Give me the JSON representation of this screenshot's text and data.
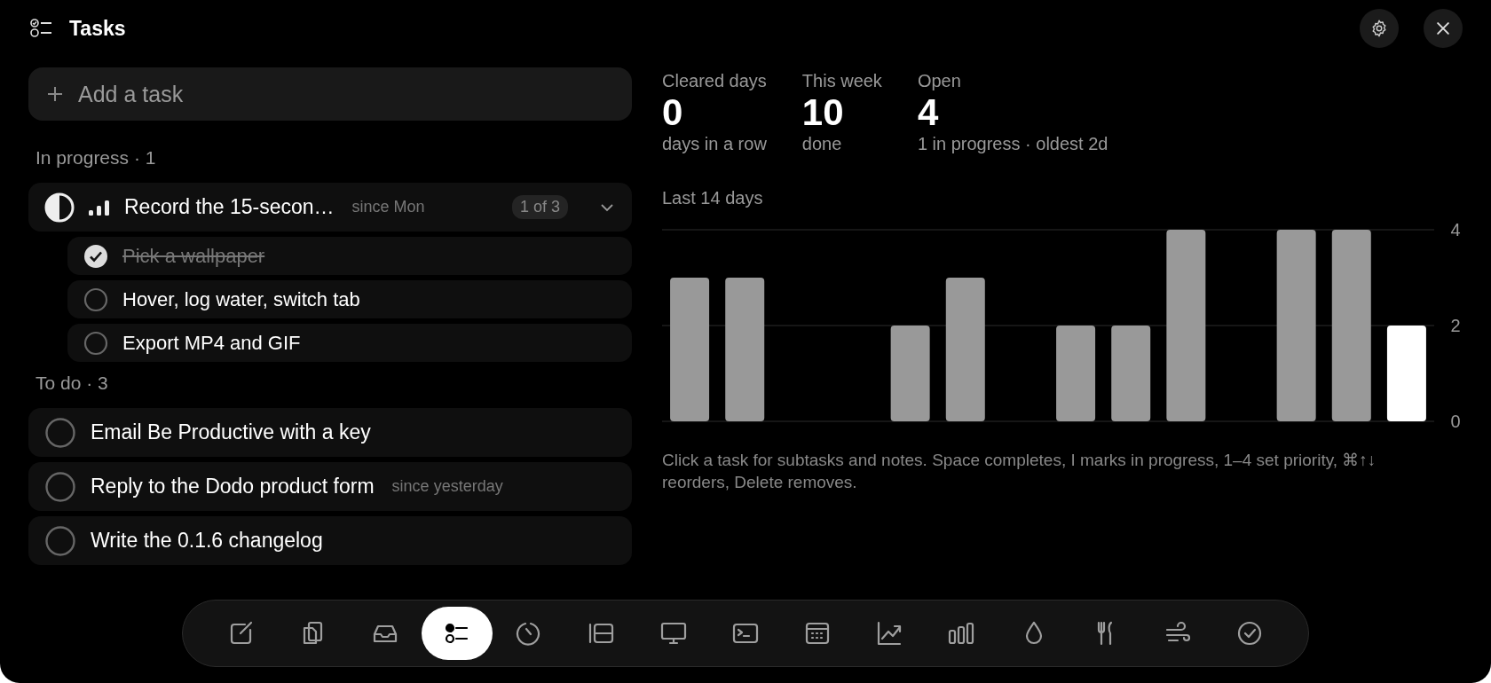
{
  "window": {
    "title": "Tasks"
  },
  "add_task": {
    "placeholder": "Add a task"
  },
  "in_progress": {
    "heading": "In progress · 1",
    "tasks": [
      {
        "title": "Record the 15-secon…",
        "since": "since Mon",
        "progress": "1 of 3",
        "expanded": true,
        "subtasks": [
          {
            "title": "Pick a wallpaper",
            "done": true
          },
          {
            "title": "Hover, log water, switch tab",
            "done": false
          },
          {
            "title": "Export MP4 and GIF",
            "done": false
          }
        ]
      }
    ]
  },
  "to_do": {
    "heading": "To do · 3",
    "tasks": [
      {
        "title": "Email Be Productive with a key",
        "done": false
      },
      {
        "title": "Reply to the Dodo product form",
        "since": "since yesterday",
        "done": false
      },
      {
        "title": "Write the 0.1.6 changelog",
        "done": false
      }
    ]
  },
  "stats": [
    {
      "label": "Cleared days",
      "value": "0",
      "detail": "days in a row"
    },
    {
      "label": "This week",
      "value": "10",
      "detail": "done"
    },
    {
      "label": "Open",
      "value": "4",
      "detail": "1 in progress · oldest 2d"
    }
  ],
  "chart_data": {
    "type": "bar",
    "title": "Last 14 days",
    "ylim": [
      0,
      4
    ],
    "yticks": [
      0,
      2,
      4
    ],
    "series": [
      {
        "color": "#999999",
        "values": [
          3,
          3,
          0,
          0,
          2,
          3,
          0,
          2,
          2,
          4,
          0,
          4,
          4,
          null
        ]
      },
      {
        "color": "#ffffff",
        "values": [
          null,
          null,
          null,
          null,
          null,
          null,
          null,
          null,
          null,
          null,
          null,
          null,
          null,
          2
        ]
      }
    ]
  },
  "hint": "Click a task for subtasks and notes. Space completes, I marks in progress, 1–4 set priority, ⌘↑↓ reorders, Delete removes.",
  "dock": [
    {
      "selected": false
    },
    {
      "selected": false
    },
    {
      "selected": false
    },
    {
      "selected": true
    },
    {
      "selected": false
    },
    {
      "selected": false
    },
    {
      "selected": false
    },
    {
      "selected": false
    },
    {
      "selected": false
    },
    {
      "selected": false
    },
    {
      "selected": false
    },
    {
      "selected": false
    },
    {
      "selected": false
    },
    {
      "selected": false
    },
    {
      "selected": false
    }
  ]
}
